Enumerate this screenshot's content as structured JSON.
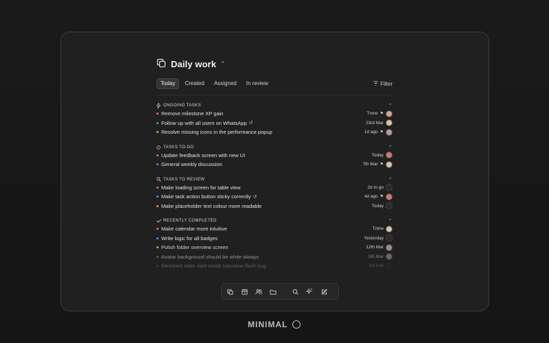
{
  "header": {
    "title": "Daily work",
    "title_icon": "copy-icon"
  },
  "tabs": [
    {
      "label": "Today",
      "active": true
    },
    {
      "label": "Created",
      "active": false
    },
    {
      "label": "Assigned",
      "active": false
    },
    {
      "label": "In review",
      "active": false
    }
  ],
  "filter_label": "Filter",
  "sections": {
    "ongoing": {
      "title": "ONGOING TASKS",
      "tasks": [
        {
          "label": "Remove milestone XP gain",
          "date": "Tmrw"
        },
        {
          "label": "Follow up with all users on WhatsApp",
          "date": "23rd Mar"
        },
        {
          "label": "Resolve missing icons in the performance popup",
          "date": "1d ago"
        }
      ]
    },
    "todo": {
      "title": "TASKS TO-DO",
      "tasks": [
        {
          "label": "Update feedback screen with new UI",
          "date": "Today"
        },
        {
          "label": "General weekly discussion",
          "date": "7th Mar"
        }
      ]
    },
    "review": {
      "title": "TASKS TO REVIEW",
      "tasks": [
        {
          "label": "Make loading screen for table view",
          "date": "2d to go"
        },
        {
          "label": "Make task action button sticky correctly",
          "date": "4d ago"
        },
        {
          "label": "Make placeholder text colour more readable",
          "date": "Today"
        }
      ]
    },
    "completed": {
      "title": "RECENTLY COMPLETED",
      "tasks": [
        {
          "label": "Make calendar more intuitive",
          "date": "Tmrw"
        },
        {
          "label": "Write logic for all badges",
          "date": "Yesterday"
        },
        {
          "label": "Polish folder overview screen",
          "date": "12th Mar"
        },
        {
          "label": "Avatar background should be white always",
          "date": "5th Mar"
        },
        {
          "label": "Members table dark-mode transition flash bug",
          "date": "1st Feb"
        }
      ]
    }
  },
  "dot_colors": {
    "pink": "#e46a8a",
    "blue": "#5b8def",
    "orange": "#e0a040",
    "purple": "#9b7be0"
  },
  "brand": {
    "text": "MINIMAL"
  }
}
